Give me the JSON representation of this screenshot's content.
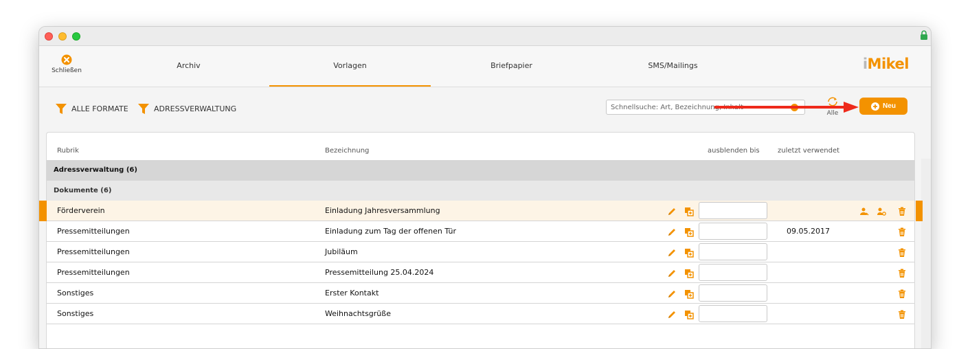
{
  "nav": {
    "close_label": "Schließen",
    "tabs": [
      {
        "label": "Archiv"
      },
      {
        "label": "Vorlagen"
      },
      {
        "label": "Briefpapier"
      },
      {
        "label": "SMS/Mailings"
      }
    ],
    "active_tab": "Vorlagen",
    "logo": {
      "prefix": "i",
      "rest": "Mikel"
    }
  },
  "toolbar": {
    "filters": [
      {
        "label": "ALLE FORMATE"
      },
      {
        "label": "ADRESSVERWALTUNG"
      }
    ],
    "search_placeholder": "Schnellsuche: Art, Bezeichnung, Inhalt",
    "refresh_label": "Alle",
    "new_label": "Neu"
  },
  "table": {
    "columns": [
      "Rubrik",
      "Bezeichnung",
      "ausblenden bis",
      "zuletzt verwendet"
    ],
    "group_primary": "Adressverwaltung (6)",
    "group_secondary": "Dokumente (6)",
    "rows": [
      {
        "rubrik": "Förderverein",
        "bezeichnung": "Einladung Jahresversammlung",
        "ausblenden_bis": "",
        "zuletzt": "",
        "selected": true
      },
      {
        "rubrik": "Pressemitteilungen",
        "bezeichnung": "Einladung zum Tag der offenen Tür",
        "ausblenden_bis": "",
        "zuletzt": "09.05.2017",
        "selected": false
      },
      {
        "rubrik": "Pressemitteilungen",
        "bezeichnung": "Jubiläum",
        "ausblenden_bis": "",
        "zuletzt": "",
        "selected": false
      },
      {
        "rubrik": "Pressemitteilungen",
        "bezeichnung": "Pressemitteilung 25.04.2024",
        "ausblenden_bis": "",
        "zuletzt": "",
        "selected": false
      },
      {
        "rubrik": "Sonstiges",
        "bezeichnung": "Erster Kontakt",
        "ausblenden_bis": "",
        "zuletzt": "",
        "selected": false
      },
      {
        "rubrik": "Sonstiges",
        "bezeichnung": "Weihnachtsgrüße",
        "ausblenden_bis": "",
        "zuletzt": "",
        "selected": false
      }
    ]
  },
  "icons": {
    "row_actions": [
      "pencil-icon",
      "copy-icon",
      "trash-icon"
    ],
    "selected_row_extra": [
      "user-assign-icon",
      "user-unassign-icon"
    ]
  },
  "colors": {
    "accent": "#f39200",
    "arrow": "#ee2a1b",
    "selected_row": "#fdf4e6",
    "group_header": "#d6d6d6"
  }
}
